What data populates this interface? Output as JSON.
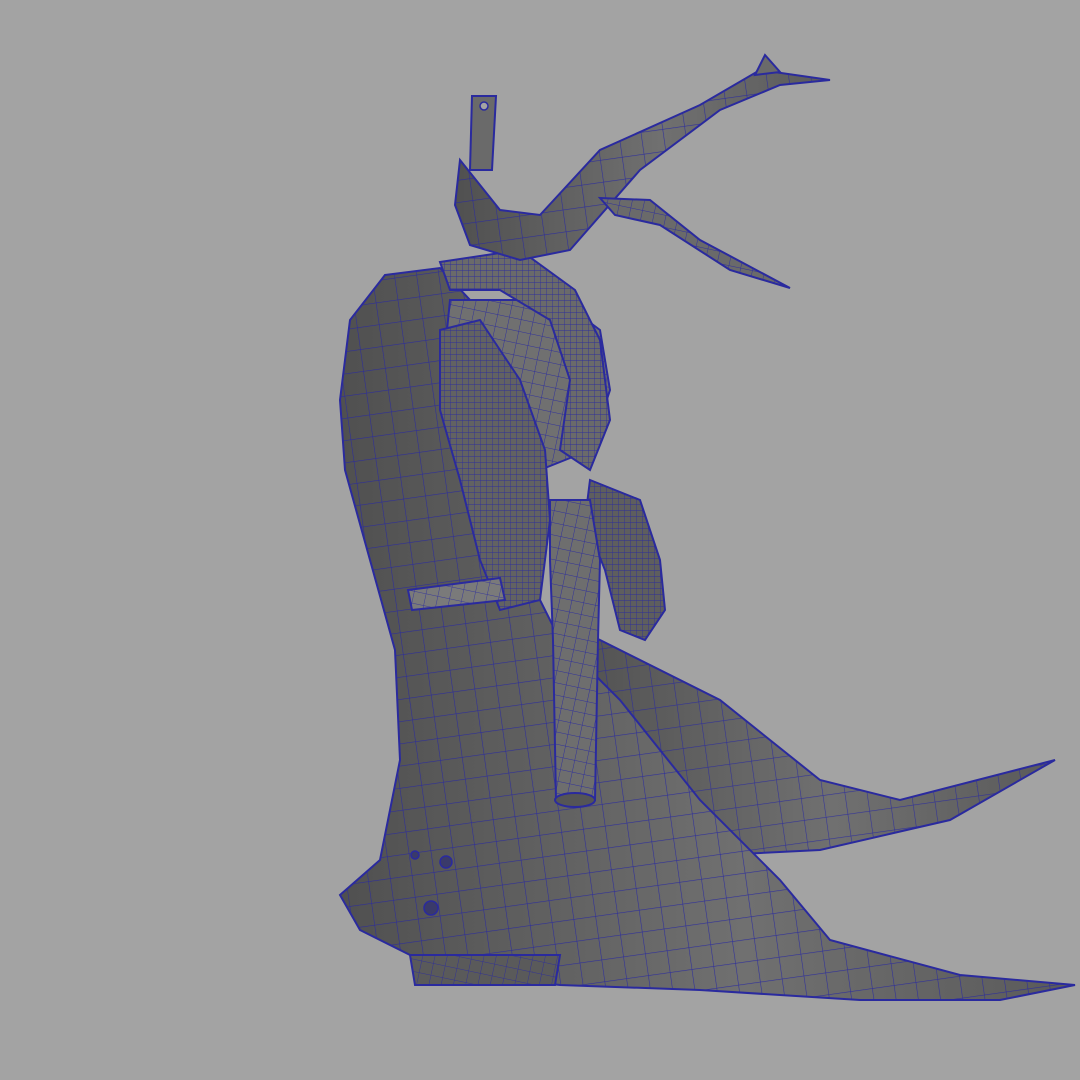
{
  "viewport": {
    "background": "#a3a3a3",
    "mesh_fill": "#666666",
    "mesh_shadow": "#4f4f4f",
    "mesh_highlight": "#8a8a8a",
    "wire_color": "#2a2a9e"
  },
  "model": {
    "subject": "wireframe-character-in-long-coat",
    "parts": [
      "hat",
      "scarf",
      "coat",
      "coat-tail-left",
      "coat-tail-right",
      "arm",
      "pistol",
      "holster-strap",
      "boot"
    ]
  }
}
